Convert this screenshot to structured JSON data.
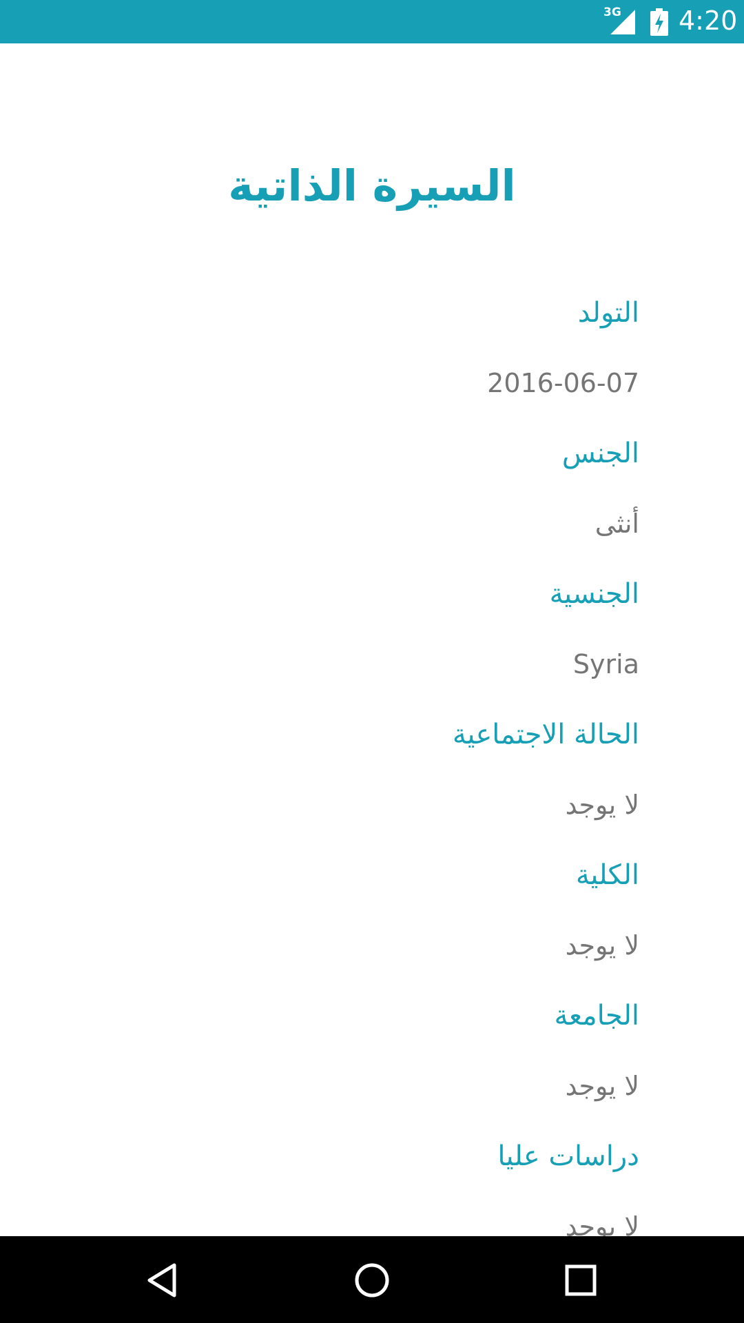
{
  "status_bar": {
    "network_type": "3G",
    "time": "4:20",
    "background_color": "#169fb5",
    "icons": [
      "signal-icon",
      "battery-charging-icon"
    ]
  },
  "page": {
    "title": "السيرة الذاتية",
    "accent_color": "#169fb5",
    "value_color": "#757575"
  },
  "fields": [
    {
      "label": "التولد",
      "value": "2016-06-07"
    },
    {
      "label": "الجنس",
      "value": "أنثى"
    },
    {
      "label": "الجنسية",
      "value": "Syria"
    },
    {
      "label": "الحالة الاجتماعية",
      "value": "لا يوجد"
    },
    {
      "label": "الكلية",
      "value": "لا يوجد"
    },
    {
      "label": "الجامعة",
      "value": "لا يوجد"
    },
    {
      "label": "دراسات عليا",
      "value": "لا يوجد"
    }
  ],
  "nav_bar": {
    "buttons": [
      "back-icon",
      "home-icon",
      "recents-icon"
    ]
  }
}
